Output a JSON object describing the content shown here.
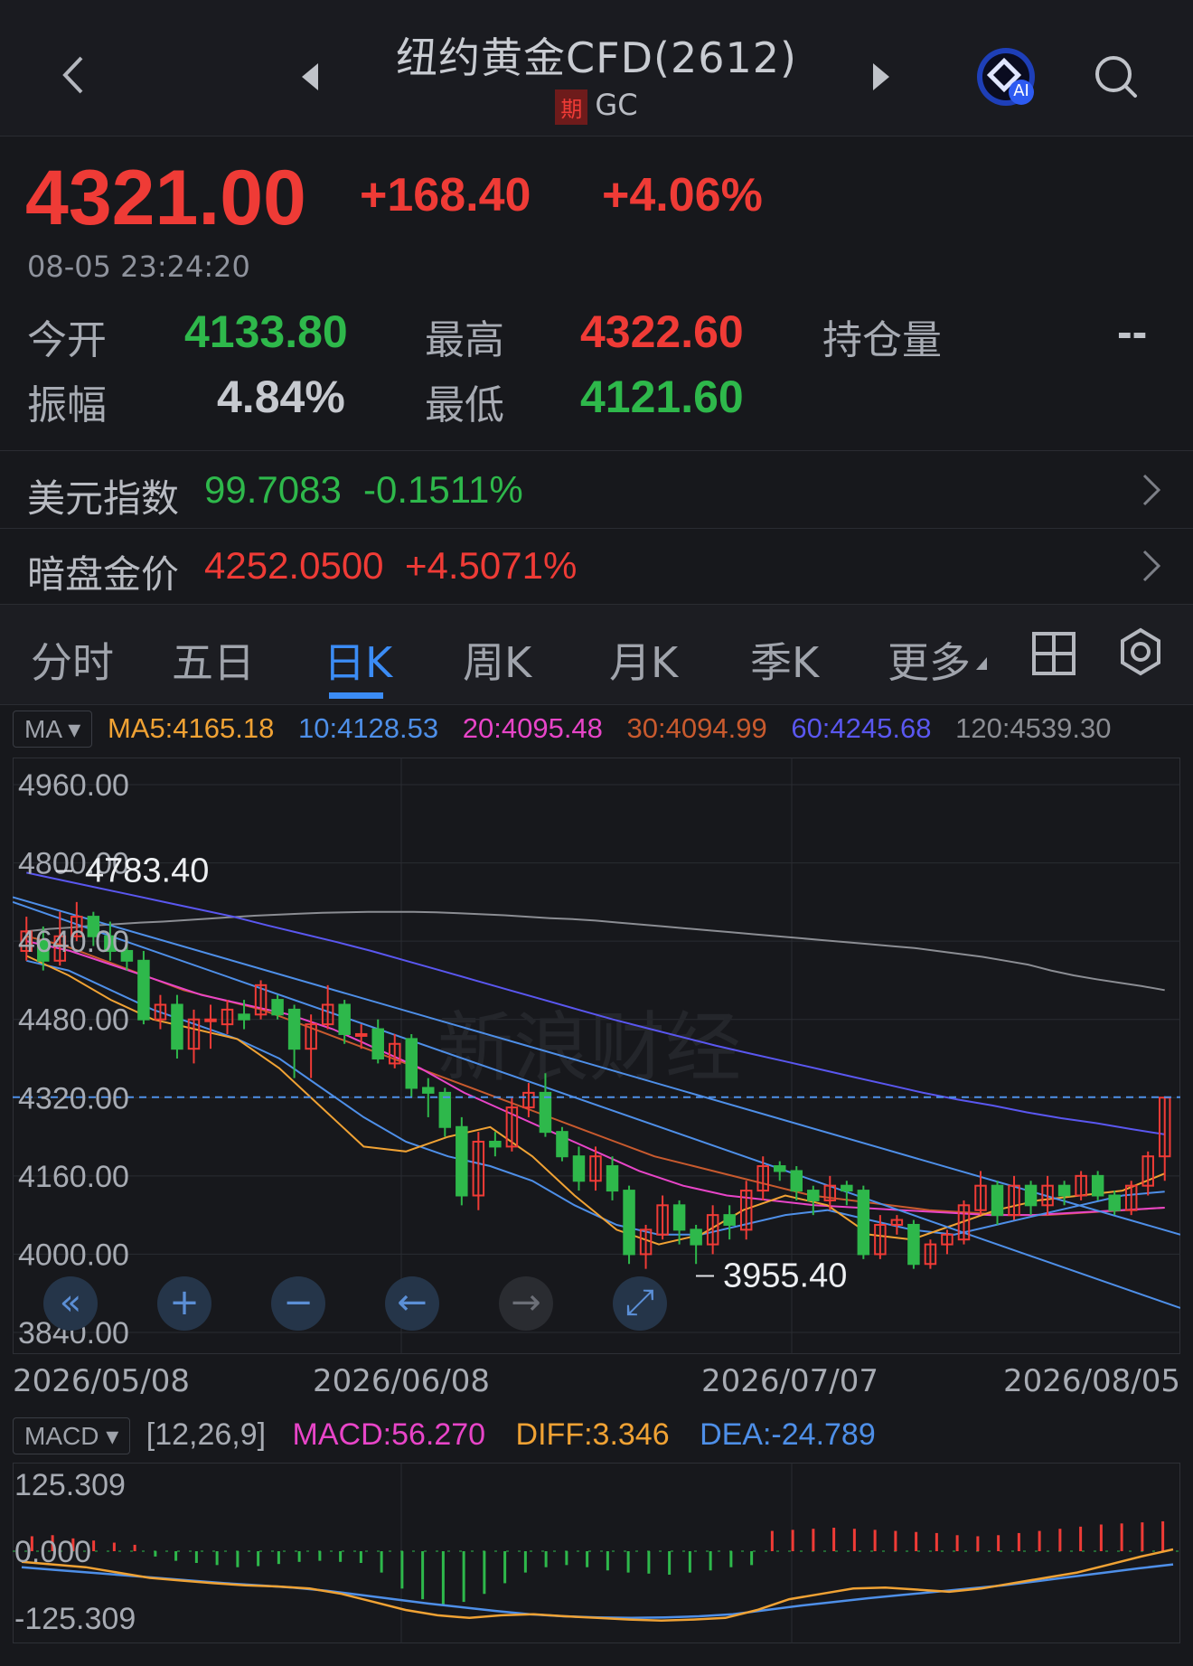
{
  "header": {
    "title": "纽约黄金CFD(2612)",
    "badge": "期",
    "code": "GC",
    "ai_label": "AI"
  },
  "quote": {
    "price": "4321.00",
    "change": "+168.40",
    "change_pct": "+4.06%",
    "time": "08-05 23:24:20",
    "open_label": "今开",
    "open": "4133.80",
    "high_label": "最高",
    "high": "4322.60",
    "oi_label": "持仓量",
    "oi": "--",
    "amp_label": "振幅",
    "amp": "4.84%",
    "low_label": "最低",
    "low": "4121.60"
  },
  "indices": [
    {
      "label": "美元指数",
      "value": "99.7083",
      "change": "-0.1511%"
    },
    {
      "label": "暗盘金价",
      "value": "4252.0500",
      "change": "+4.5071%"
    }
  ],
  "tabs": [
    "分时",
    "五日",
    "日K",
    "周K",
    "月K",
    "季K",
    "更多"
  ],
  "active_tab": "日K",
  "ma": {
    "selector": "MA",
    "ma5": "MA5:4165.18",
    "ma10": "10:4128.53",
    "ma20": "20:4095.48",
    "ma30": "30:4094.99",
    "ma60": "60:4245.68",
    "ma120": "120:4539.30"
  },
  "colors": {
    "up": "#ef3b36",
    "down": "#2eb84b",
    "ma5": "#f0a234",
    "ma10": "#4e8fe8",
    "ma20": "#e845c8",
    "ma30": "#c85a2e",
    "ma60": "#5a57f0",
    "ma120": "#8b8d93"
  },
  "watermark": "新浪财经",
  "chart_data": [
    {
      "type": "candlestick",
      "y_ticks": [
        "4960.00",
        "4800.00",
        "4640.00",
        "4480.00",
        "4320.00",
        "4160.00",
        "4000.00",
        "3840.00"
      ],
      "ylim": [
        3840,
        4960
      ],
      "x_ticks": [
        "2026/05/08",
        "2026/06/08",
        "2026/07/07",
        "2026/08/05"
      ],
      "max_label": "4783.40",
      "min_label": "3955.40",
      "current_price_line": 4321,
      "candles": [
        [
          4620,
          4660,
          4600,
          4690
        ],
        [
          4640,
          4600,
          4580,
          4670
        ],
        [
          4600,
          4650,
          4590,
          4700
        ],
        [
          4650,
          4690,
          4640,
          4720
        ],
        [
          4690,
          4650,
          4630,
          4700
        ],
        [
          4650,
          4620,
          4600,
          4680
        ],
        [
          4620,
          4600,
          4580,
          4650
        ],
        [
          4600,
          4480,
          4470,
          4620
        ],
        [
          4480,
          4510,
          4460,
          4530
        ],
        [
          4510,
          4420,
          4400,
          4530
        ],
        [
          4420,
          4480,
          4390,
          4500
        ],
        [
          4480,
          4480,
          4420,
          4510
        ],
        [
          4470,
          4500,
          4450,
          4520
        ],
        [
          4490,
          4480,
          4460,
          4520
        ],
        [
          4490,
          4550,
          4480,
          4560
        ],
        [
          4520,
          4490,
          4480,
          4530
        ],
        [
          4500,
          4420,
          4360,
          4510
        ],
        [
          4420,
          4470,
          4360,
          4490
        ],
        [
          4470,
          4510,
          4460,
          4550
        ],
        [
          4510,
          4450,
          4430,
          4520
        ],
        [
          4450,
          4450,
          4420,
          4470
        ],
        [
          4460,
          4400,
          4390,
          4480
        ],
        [
          4390,
          4430,
          4380,
          4450
        ],
        [
          4440,
          4340,
          4320,
          4450
        ],
        [
          4340,
          4330,
          4280,
          4360
        ],
        [
          4330,
          4260,
          4240,
          4340
        ],
        [
          4260,
          4120,
          4100,
          4280
        ],
        [
          4120,
          4230,
          4090,
          4250
        ],
        [
          4230,
          4220,
          4200,
          4250
        ],
        [
          4220,
          4300,
          4210,
          4320
        ],
        [
          4300,
          4330,
          4280,
          4350
        ],
        [
          4330,
          4250,
          4240,
          4370
        ],
        [
          4250,
          4200,
          4190,
          4260
        ],
        [
          4200,
          4150,
          4130,
          4220
        ],
        [
          4150,
          4200,
          4130,
          4220
        ],
        [
          4180,
          4130,
          4110,
          4200
        ],
        [
          4130,
          4000,
          3980,
          4140
        ],
        [
          4000,
          4050,
          3970,
          4060
        ],
        [
          4040,
          4100,
          4030,
          4120
        ],
        [
          4100,
          4050,
          4020,
          4110
        ],
        [
          4050,
          4020,
          3980,
          4060
        ],
        [
          4020,
          4080,
          4000,
          4100
        ],
        [
          4080,
          4060,
          4030,
          4100
        ],
        [
          4050,
          4130,
          4030,
          4150
        ],
        [
          4130,
          4180,
          4110,
          4200
        ],
        [
          4180,
          4170,
          4150,
          4190
        ],
        [
          4170,
          4130,
          4110,
          4180
        ],
        [
          4130,
          4110,
          4080,
          4140
        ],
        [
          4110,
          4140,
          4090,
          4160
        ],
        [
          4140,
          4130,
          4100,
          4150
        ],
        [
          4130,
          4000,
          3990,
          4140
        ],
        [
          4000,
          4060,
          3990,
          4080
        ],
        [
          4060,
          4070,
          4040,
          4080
        ],
        [
          4060,
          3980,
          3970,
          4070
        ],
        [
          3980,
          4020,
          3970,
          4030
        ],
        [
          4020,
          4040,
          4000,
          4050
        ],
        [
          4030,
          4100,
          4020,
          4110
        ],
        [
          4090,
          4140,
          4080,
          4170
        ],
        [
          4140,
          4080,
          4060,
          4150
        ],
        [
          4080,
          4140,
          4070,
          4160
        ],
        [
          4140,
          4100,
          4080,
          4150
        ],
        [
          4100,
          4140,
          4080,
          4160
        ],
        [
          4140,
          4120,
          4100,
          4150
        ],
        [
          4120,
          4160,
          4110,
          4170
        ],
        [
          4160,
          4120,
          4110,
          4170
        ],
        [
          4120,
          4090,
          4080,
          4130
        ],
        [
          4090,
          4140,
          4080,
          4150
        ],
        [
          4140,
          4200,
          4120,
          4210
        ],
        [
          4200,
          4320,
          4150,
          4322.6
        ]
      ],
      "ma120": [
        4660,
        4665,
        4668,
        4672,
        4675,
        4678,
        4680,
        4683,
        4686,
        4689,
        4692,
        4694,
        4696,
        4698,
        4699,
        4700,
        4700,
        4700,
        4699,
        4697,
        4695,
        4693,
        4690,
        4687,
        4685,
        4682,
        4678,
        4674,
        4670,
        4666,
        4662,
        4658,
        4654,
        4650,
        4646,
        4642,
        4638,
        4634,
        4630,
        4626,
        4620,
        4614,
        4608,
        4600,
        4592,
        4580,
        4570,
        4562,
        4555,
        4548,
        4540
      ],
      "ma60": [
        4780,
        4765,
        4750,
        4735,
        4720,
        4705,
        4690,
        4672,
        4655,
        4638,
        4620,
        4600,
        4580,
        4560,
        4540,
        4520,
        4500,
        4480,
        4462,
        4444,
        4426,
        4410,
        4394,
        4378,
        4362,
        4346,
        4330,
        4316,
        4304,
        4290,
        4278,
        4268,
        4256,
        4245
      ],
      "ma30": [
        4650,
        4630,
        4600,
        4570,
        4540,
        4520,
        4500,
        4470,
        4440,
        4410,
        4380,
        4350,
        4320,
        4290,
        4260,
        4230,
        4200,
        4180,
        4160,
        4140,
        4120,
        4110,
        4100,
        4090,
        4085,
        4080,
        4080,
        4085,
        4090,
        4095
      ],
      "ma20": [
        4640,
        4620,
        4590,
        4560,
        4530,
        4510,
        4490,
        4460,
        4420,
        4380,
        4330,
        4290,
        4250,
        4210,
        4170,
        4140,
        4120,
        4110,
        4100,
        4095,
        4090,
        4085,
        4080,
        4080,
        4085,
        4090,
        4095
      ],
      "ma10": [
        4600,
        4580,
        4540,
        4500,
        4470,
        4440,
        4400,
        4340,
        4280,
        4230,
        4200,
        4180,
        4150,
        4100,
        4060,
        4040,
        4040,
        4060,
        4080,
        4090,
        4070,
        4050,
        4040,
        4060,
        4080,
        4100,
        4120,
        4128
      ],
      "ma5": [
        4610,
        4570,
        4520,
        4480,
        4460,
        4440,
        4380,
        4300,
        4220,
        4210,
        4240,
        4260,
        4200,
        4120,
        4050,
        4020,
        4040,
        4090,
        4120,
        4100,
        4040,
        4030,
        4060,
        4090,
        4110,
        4120,
        4130,
        4165
      ],
      "trend_lines": [
        [
          4720,
          3890
        ],
        [
          4730,
          4040
        ]
      ]
    },
    {
      "type": "bar",
      "indicator_label": "MACD",
      "params": "[12,26,9]",
      "macd_label": "MACD:56.270",
      "diff_label": "DIFF:3.346",
      "dea_label": "DEA:-24.789",
      "y_ticks": [
        "125.309",
        "0.000",
        "-125.309"
      ],
      "ylim": [
        -125.309,
        125.309
      ],
      "hist": [
        28,
        30,
        24,
        20,
        16,
        12,
        -10,
        -18,
        -22,
        -26,
        -30,
        -28,
        -24,
        -20,
        -18,
        -20,
        -22,
        -40,
        -70,
        -90,
        -100,
        -95,
        -80,
        -60,
        -40,
        -30,
        -26,
        -30,
        -36,
        -40,
        -42,
        -44,
        -40,
        -36,
        -30,
        -26,
        38,
        40,
        42,
        44,
        42,
        40,
        38,
        36,
        34,
        30,
        28,
        30,
        34,
        38,
        42,
        46,
        50,
        52,
        54,
        56
      ],
      "diff": [
        -20,
        -25,
        -30,
        -40,
        -50,
        -55,
        -60,
        -64,
        -66,
        -70,
        -80,
        -95,
        -110,
        -120,
        -125,
        -120,
        -118,
        -122,
        -125,
        -128,
        -130,
        -128,
        -125,
        -110,
        -90,
        -80,
        -70,
        -68,
        -72,
        -76,
        -70,
        -60,
        -50,
        -40,
        -25,
        -10,
        3.346
      ],
      "dea": [
        -30,
        -35,
        -40,
        -45,
        -50,
        -55,
        -60,
        -64,
        -68,
        -74,
        -82,
        -90,
        -98,
        -105,
        -112,
        -118,
        -122,
        -124,
        -125,
        -124,
        -122,
        -118,
        -110,
        -102,
        -95,
        -88,
        -82,
        -76,
        -70,
        -64,
        -56,
        -48,
        -40,
        -32,
        -24.789
      ]
    }
  ]
}
